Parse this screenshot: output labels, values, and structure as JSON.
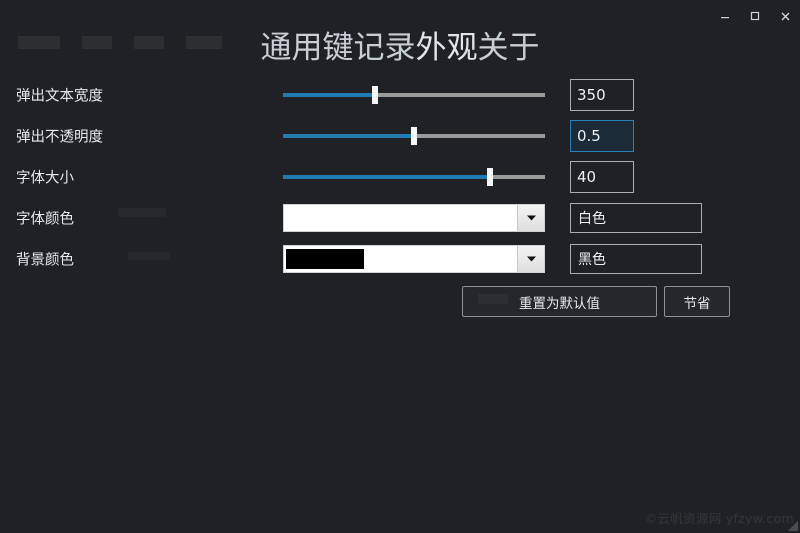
{
  "window": {
    "controls": [
      {
        "name": "minimize",
        "glyph": "minimize-icon",
        "label": "–"
      },
      {
        "name": "maximize",
        "glyph": "maximize-icon",
        "label": "□"
      },
      {
        "name": "close",
        "glyph": "close-icon",
        "label": "×"
      }
    ]
  },
  "tabs": [
    {
      "label": "通用",
      "active": false
    },
    {
      "label": "键记录",
      "active": false
    },
    {
      "label": "外观",
      "active": true
    },
    {
      "label": "关于",
      "active": false
    }
  ],
  "form": {
    "rows": [
      {
        "label": "弹出文本宽度",
        "type": "slider",
        "value": "350",
        "percent": 35,
        "focused": false
      },
      {
        "label": "弹出不透明度",
        "type": "slider",
        "value": "0.5",
        "percent": 50,
        "focused": true
      },
      {
        "label": "字体大小",
        "type": "slider",
        "value": "40",
        "percent": 79,
        "focused": false
      },
      {
        "label": "字体颜色",
        "type": "color",
        "value": "白色",
        "swatch": "#ffffff",
        "swatch_visible": false
      },
      {
        "label": "背景颜色",
        "type": "color",
        "value": "黑色",
        "swatch": "#000000",
        "swatch_visible": true
      }
    ]
  },
  "buttons": {
    "reset": "重置为默认值",
    "save": "节省"
  },
  "watermark": "©云帆资源网 yfzyw.com",
  "colors": {
    "background": "#1f2124",
    "slider_fill": "#1f7bb0",
    "slider_track": "#9a9a9a",
    "focus_border": "#2b80b8",
    "focus_bg": "#1b2b38",
    "text": "#e6e9ec"
  }
}
